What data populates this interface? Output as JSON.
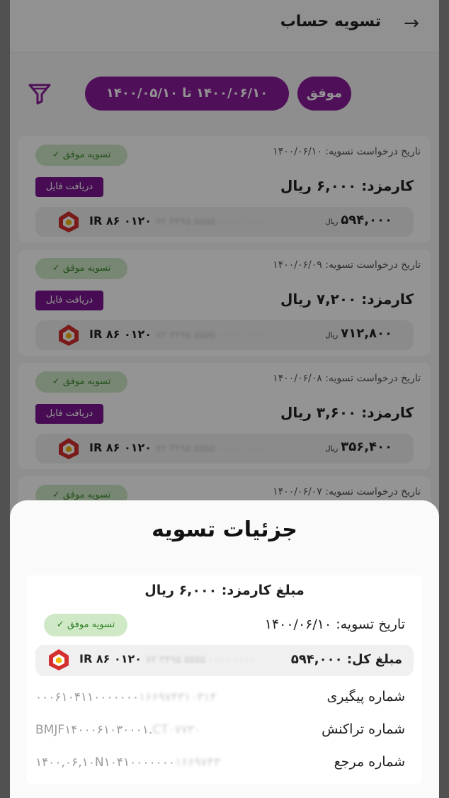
{
  "header": {
    "title": "تسویه حساب"
  },
  "filters": {
    "status": "موفق",
    "date_range": "۱۴۰۰/۰۶/۱۰ تا ۱۴۰۰/۰۵/۱۰"
  },
  "cards": [
    {
      "date": "تاریخ درخواست تسویه: ۱۴۰۰/۰۶/۱۰",
      "status": "تسویه موفق",
      "fee": "کارمزد: ۶,۰۰۰ ریال",
      "file_button": "دریافت فایل",
      "amount": "۵۹۴,۰۰۰",
      "currency": "ریال",
      "iban": "IR ۸۶ ۰۱۲۰",
      "iban_masked": "۷۲ ۳۴۹۵ ۵۵۵۵ ۰۰۰۰ ۰۰۰۰"
    },
    {
      "date": "تاریخ درخواست تسویه: ۱۴۰۰/۰۶/۰۹",
      "status": "تسویه موفق",
      "fee": "کارمزد: ۷,۲۰۰ ریال",
      "file_button": "دریافت فایل",
      "amount": "۷۱۲,۸۰۰",
      "currency": "ریال",
      "iban": "IR ۸۶ ۰۱۲۰",
      "iban_masked": "۷۲ ۳۴۹۵ ۵۵۵۵ ۰۰۰۰ ۰۰۰۰"
    },
    {
      "date": "تاریخ درخواست تسویه: ۱۴۰۰/۰۶/۰۸",
      "status": "تسویه موفق",
      "fee": "کارمزد: ۳,۶۰۰ ریال",
      "file_button": "دریافت فایل",
      "amount": "۳۵۶,۴۰۰",
      "currency": "ریال",
      "iban": "IR ۸۶ ۰۱۲۰",
      "iban_masked": "۷۲ ۳۴۹۵ ۵۵۵۵ ۰۰۰۰ ۰۰۰۰"
    },
    {
      "date": "تاریخ درخواست تسویه: ۱۴۰۰/۰۶/۰۷",
      "status": "تسویه موفق"
    }
  ],
  "sheet": {
    "title": "جزئیات تسویه",
    "fee": "مبلغ کارمزد: ۶,۰۰۰ ریال",
    "date": "تاریخ تسویه: ۱۴۰۰/۰۶/۱۰",
    "status": "تسویه موفق",
    "total": "مبلغ کل: ۵۹۴,۰۰۰",
    "iban": "IR ۸۶ ۰۱۲۰",
    "iban_masked": "۷۲ ۳۴۹۵ ۵۵۵۵ ۰۰۰۰ ۰۰۰۰",
    "tracking_label": "شماره پیگیری",
    "tracking_value": "۰۰۰۶۱۰۴۱۱۰۰۰۰۰۰۰",
    "tracking_masked": "۱۶۶۹۷۴۳۱۰۳۱۴",
    "txn_label": "شماره تراکنش",
    "txn_value": "BMJF۱۴۰۰۰۶۱۰۳۰۰۰۱.",
    "txn_masked": "CT۰۷۷۳۰",
    "ref_label": "شماره مرجع",
    "ref_value": "۱۴۰۰,۰۶,۱۰N۱۰۴۱۰۰۰۰۰۰۰",
    "ref_masked": "۱۶۶۹۷۴۳"
  },
  "colors": {
    "accent": "#8a1c9a",
    "success_bg": "#cfe9c7",
    "success_fg": "#3b8a2e"
  }
}
